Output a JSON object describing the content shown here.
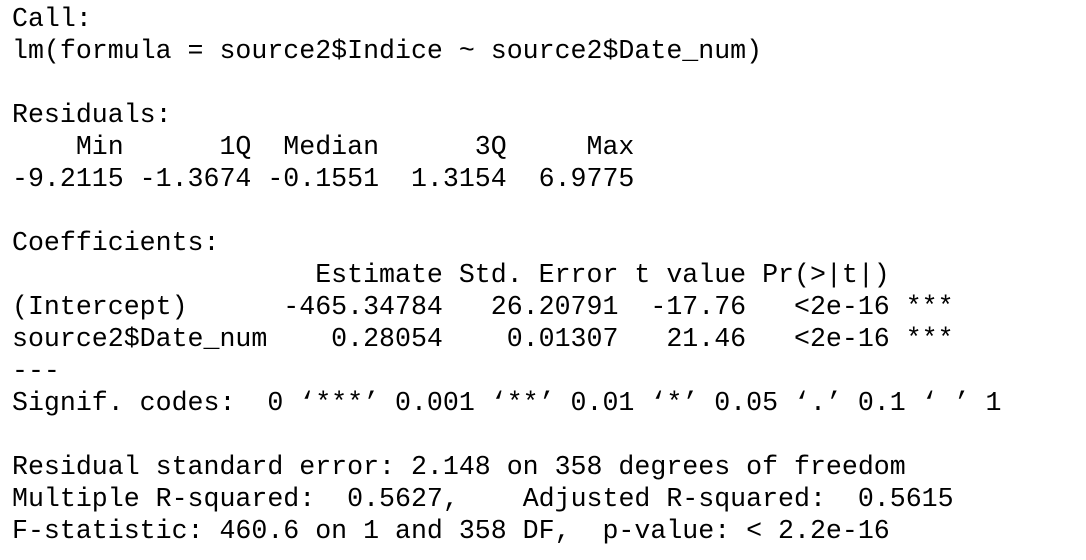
{
  "console": {
    "lines": [
      "Call:",
      "lm(formula = source2$Indice ~ source2$Date_num)",
      "",
      "Residuals:",
      "    Min      1Q  Median      3Q     Max ",
      "-9.2115 -1.3674 -0.1551  1.3154  6.9775 ",
      "",
      "Coefficients:",
      "                   Estimate Std. Error t value Pr(>|t|)    ",
      "(Intercept)      -465.34784   26.20791  -17.76   <2e-16 ***",
      "source2$Date_num    0.28054    0.01307   21.46   <2e-16 ***",
      "---",
      "Signif. codes:  0 ‘***’ 0.001 ‘**’ 0.01 ‘*’ 0.05 ‘.’ 0.1 ‘ ’ 1",
      "",
      "Residual standard error: 2.148 on 358 degrees of freedom",
      "Multiple R-squared:  0.5627,\tAdjusted R-squared:  0.5615 ",
      "F-statistic: 460.6 on 1 and 358 DF,  p-value: < 2.2e-16"
    ]
  }
}
